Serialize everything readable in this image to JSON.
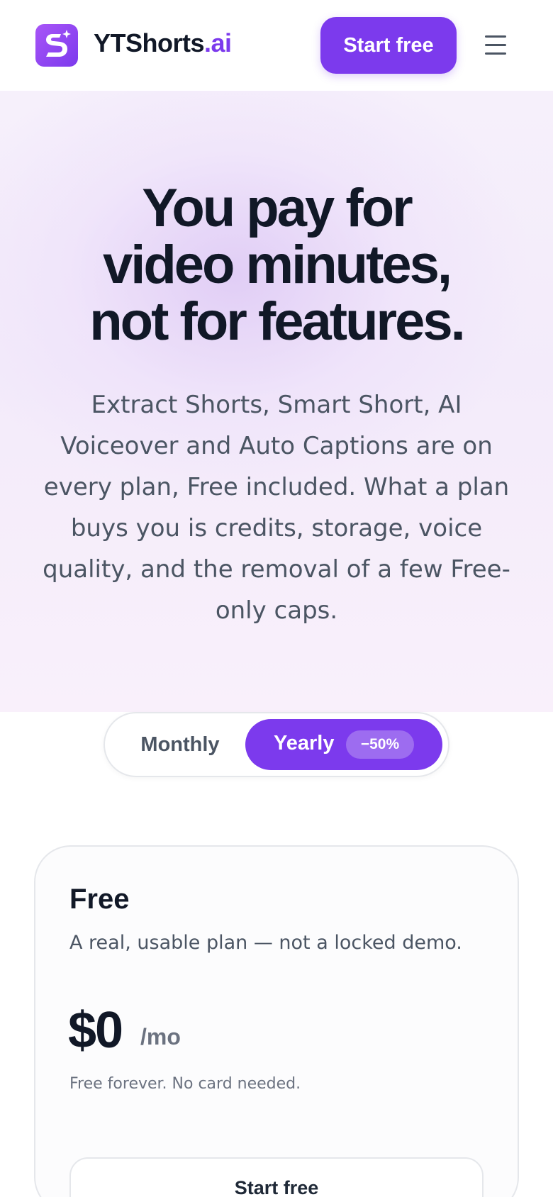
{
  "header": {
    "brand_name": "YTShorts",
    "brand_suffix": ".ai",
    "cta_label": "Start free",
    "icons": {
      "logo": "logo-icon",
      "menu": "hamburger-menu-icon"
    }
  },
  "hero": {
    "title_lines": [
      "You pay for",
      "video minutes,",
      "not for features."
    ],
    "subtitle": "Extract Shorts, Smart Short, AI Voiceover and Auto Captions are on every plan, Free included. What a plan buys you is credits, storage, voice quality, and the removal of a few Free-only caps."
  },
  "billing_toggle": {
    "monthly_label": "Monthly",
    "yearly_label": "Yearly",
    "yearly_badge": "−50%",
    "selected": "Yearly"
  },
  "plans": [
    {
      "name": "Free",
      "description": "A real, usable plan — not a locked demo.",
      "price": "$0",
      "period": "/mo",
      "note": "Free forever. No card needed.",
      "cta_label": "Start free"
    }
  ],
  "colors": {
    "accent": "#7c3aed",
    "text_dark": "#111827",
    "text_muted": "#4b5563"
  }
}
